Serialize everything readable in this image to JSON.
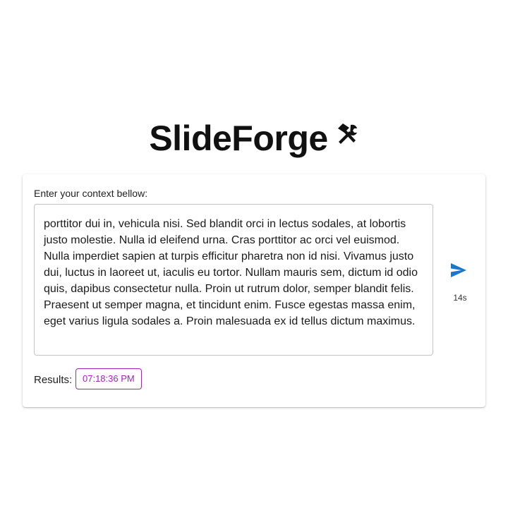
{
  "app": {
    "title": "SlideForge",
    "title_icon": "hammer-and-wrench-icon"
  },
  "form": {
    "prompt_label": "Enter your context bellow:",
    "context_text": "porttitor dui in, vehicula nisi. Sed blandit orci in lectus sodales, at lobortis justo molestie. Nulla id eleifend urna. Cras porttitor ac orci vel euismod. Nulla imperdiet sapien at turpis efficitur pharetra non id nisi. Vivamus justo dui, luctus in laoreet ut, iaculis eu tortor. Nullam mauris sem, dictum id odio quis, dapibus consectetur nulla. Proin ut rutrum dolor, semper blandit felis. Praesent ut semper magna, et tincidunt enim. Fusce egestas massa enim, eget varius ligula sodales a. Proin malesuada ex id tellus dictum maximus.",
    "send_icon": "send-icon",
    "elapsed": "14s"
  },
  "results": {
    "label": "Results:",
    "items": [
      "07:18:36 PM"
    ]
  },
  "colors": {
    "primary": "#1976d2",
    "secondary": "#9c27b0",
    "border": "#c4c4c4"
  }
}
